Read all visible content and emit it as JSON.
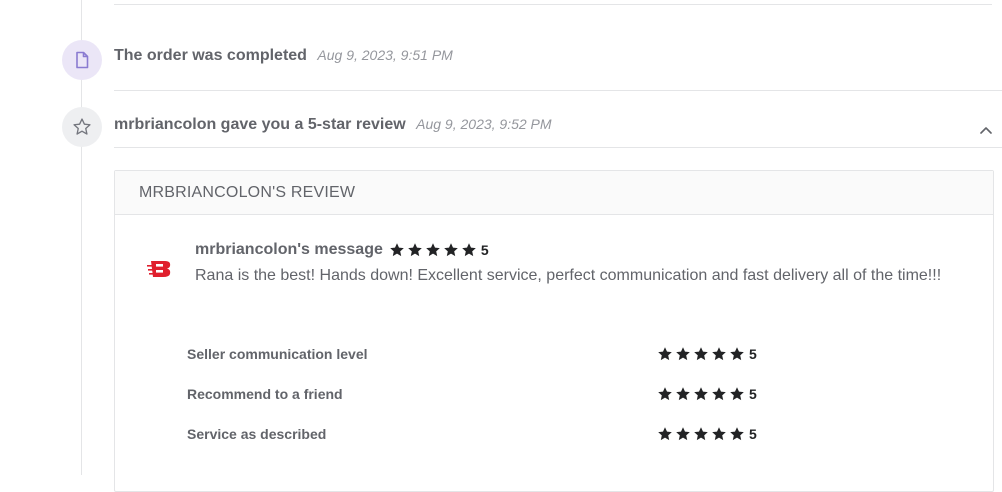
{
  "events": [
    {
      "title": "The order was completed",
      "time": "Aug 9, 2023, 9:51 PM",
      "icon": "document-icon"
    },
    {
      "title": "mrbriancolon gave you a 5-star review",
      "time": "Aug 9, 2023, 9:52 PM",
      "icon": "star-outline-icon"
    }
  ],
  "review": {
    "header": "MRBRIANCOLON'S REVIEW",
    "author_label": "mrbriancolon's message",
    "overall_score": "5",
    "message": "Rana is the best! Hands down! Excellent service, perfect communication and fast delivery all of the time!!!",
    "buyer_logo_color": "#e0202e",
    "ratings": [
      {
        "label": "Seller communication level",
        "score": "5"
      },
      {
        "label": "Recommend to a friend",
        "score": "5"
      },
      {
        "label": "Service as described",
        "score": "5"
      }
    ]
  },
  "colors": {
    "star": "#222325",
    "order_icon_bg": "#ebe6f7",
    "order_icon_stroke": "#8a7bd1",
    "review_icon_bg": "#eeeff1",
    "review_icon_stroke": "#74767e"
  }
}
